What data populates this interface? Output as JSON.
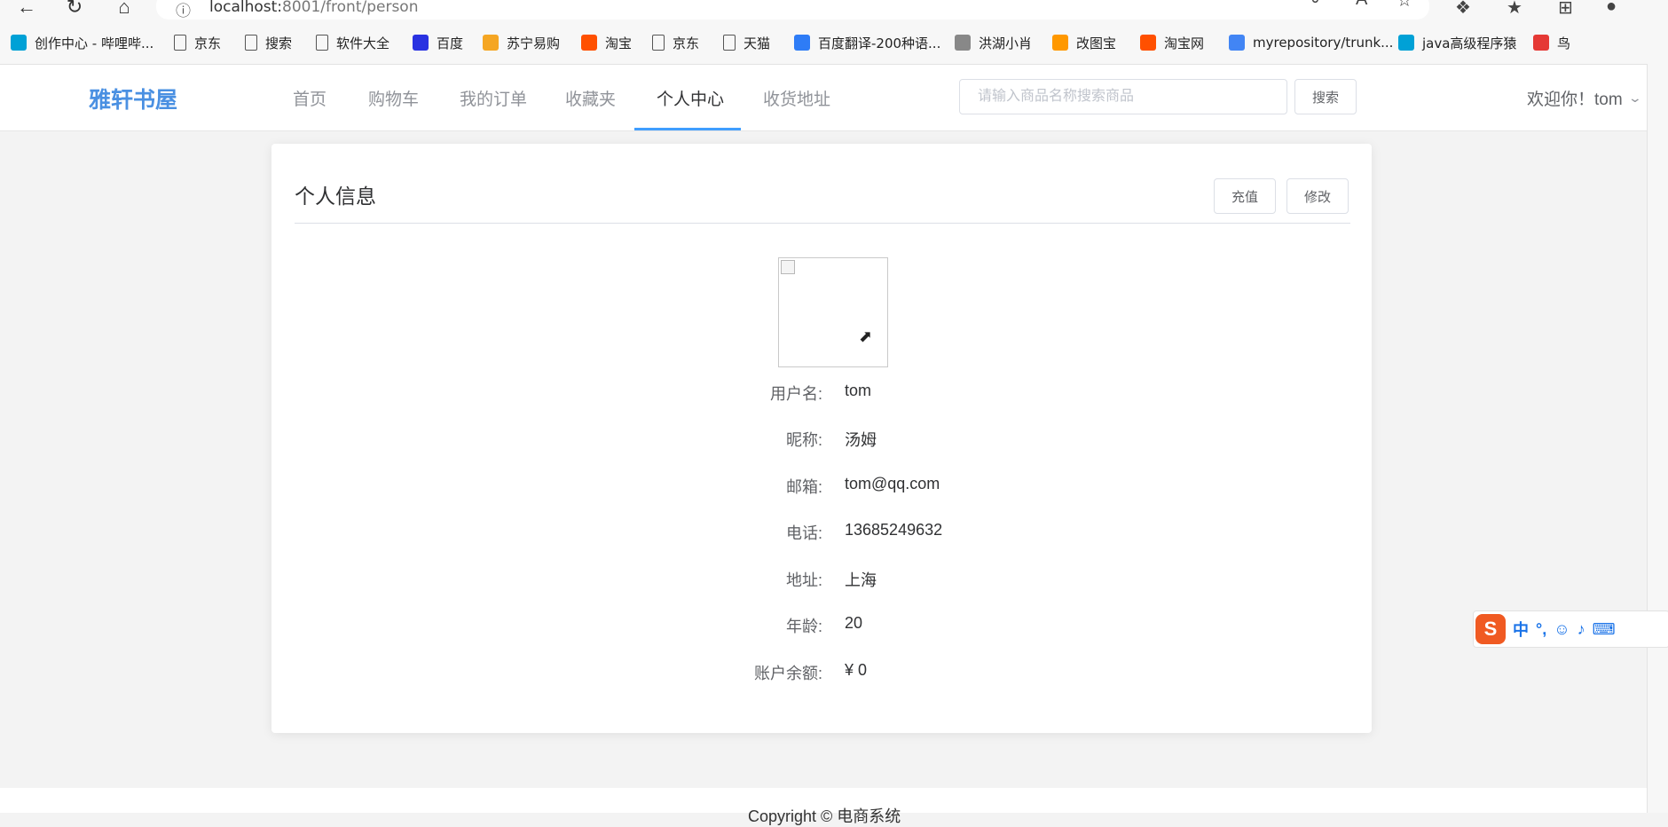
{
  "browser": {
    "url_host": "localhost:",
    "url_rest": "8001/front/person",
    "bookmarks": [
      {
        "label": "创作中心 - 哔哩哔...",
        "icon": "bilibili-icon",
        "color": "#00a1d6"
      },
      {
        "label": "京东",
        "icon": "page-icon"
      },
      {
        "label": "搜索",
        "icon": "page-icon"
      },
      {
        "label": "软件大全",
        "icon": "page-icon"
      },
      {
        "label": "百度",
        "icon": "baidu-icon",
        "color": "#2932e1"
      },
      {
        "label": "苏宁易购",
        "icon": "suning-icon",
        "color": "#f5a623"
      },
      {
        "label": "淘宝",
        "icon": "taobao-icon",
        "color": "#ff5000"
      },
      {
        "label": "京东",
        "icon": "page-icon"
      },
      {
        "label": "天猫",
        "icon": "page-icon"
      },
      {
        "label": "百度翻译-200种语...",
        "icon": "baidu-translate-icon",
        "color": "#2e7cf6"
      },
      {
        "label": "洪湖小肖",
        "icon": "bird-icon",
        "color": "#888888"
      },
      {
        "label": "改图宝",
        "icon": "gaitubao-icon",
        "color": "#ff9800"
      },
      {
        "label": "淘宝网",
        "icon": "taobao-icon",
        "color": "#ff5000"
      },
      {
        "label": "myrepository/trunk...",
        "icon": "chrome-icon",
        "color": "#4285f4"
      },
      {
        "label": "java高级程序猿",
        "icon": "bilibili-icon",
        "color": "#00a1d6"
      },
      {
        "label": "鸟",
        "icon": "bird-icon",
        "color": "#e53935"
      }
    ]
  },
  "header": {
    "logo": "雅轩书屋",
    "menu": [
      "首页",
      "购物车",
      "我的订单",
      "收藏夹",
      "个人中心",
      "收货地址"
    ],
    "active_index": 4,
    "search_placeholder": "请输入商品名称搜索商品",
    "search_button": "搜索",
    "welcome": "欢迎你！tom"
  },
  "profile": {
    "title": "个人信息",
    "recharge_button": "充值",
    "edit_button": "修改",
    "fields": [
      {
        "label": "用户名:",
        "value": "tom"
      },
      {
        "label": "昵称:",
        "value": "汤姆"
      },
      {
        "label": "邮箱:",
        "value": "tom@qq.com"
      },
      {
        "label": "电话:",
        "value": "13685249632"
      },
      {
        "label": "地址:",
        "value": "上海"
      },
      {
        "label": "年龄:",
        "value": "20"
      },
      {
        "label": "账户余额:",
        "value": "¥ 0"
      }
    ]
  },
  "footer": {
    "text": "Copyright © 电商系统"
  },
  "ime": {
    "mode": "中",
    "punct": "°,"
  },
  "colors": {
    "accent": "#409eff",
    "logo": "#4a90e2"
  }
}
